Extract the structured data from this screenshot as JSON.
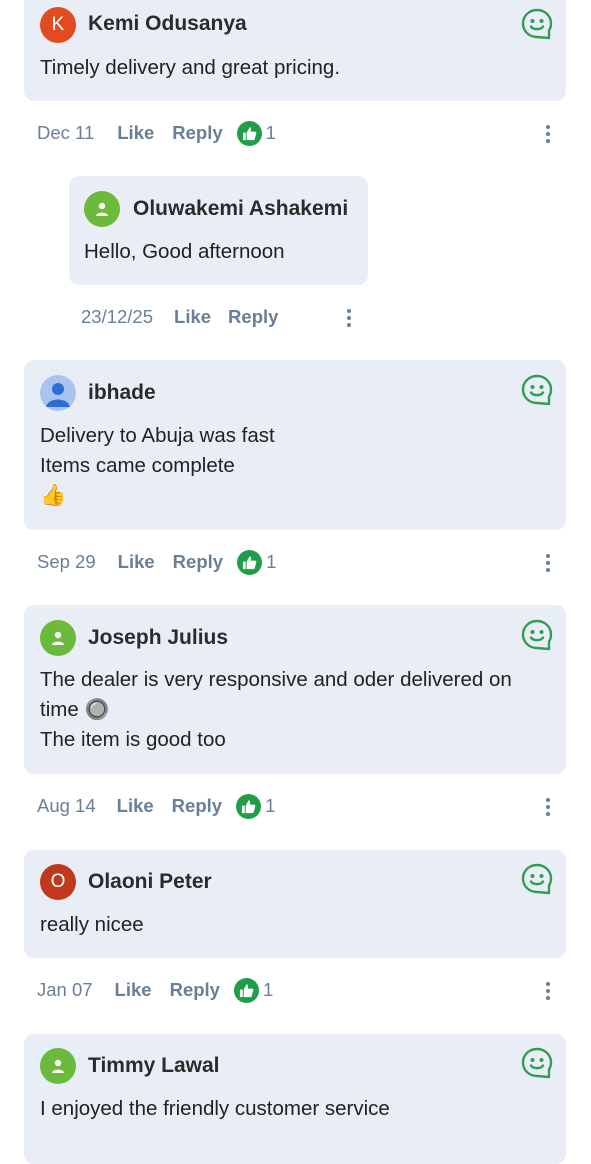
{
  "comments": [
    {
      "author": "Kemi Odusanya",
      "avatar_letter": "K",
      "avatar_color": "#e24a22",
      "lines": [
        "Timely delivery and great pricing."
      ],
      "date": "Dec 11",
      "like_label": "Like",
      "reply_label": "Reply",
      "like_count": "1"
    },
    {
      "author": "Oluwakemi Ashakemi",
      "avatar_icon": "person-icon",
      "avatar_color": "#6cba3c",
      "lines": [
        "Hello, Good afternoon"
      ],
      "date": "23/12/25",
      "like_label": "Like",
      "reply_label": "Reply",
      "is_reply": true
    },
    {
      "author": "ibhade",
      "avatar_icon": "person-icon",
      "avatar_color": "#a9c4ee",
      "lines": [
        "Delivery to Abuja was fast",
        "Items came complete"
      ],
      "emoji": "👍",
      "date": "Sep 29",
      "like_label": "Like",
      "reply_label": "Reply",
      "like_count": "1"
    },
    {
      "author": "Joseph Julius",
      "avatar_icon": "person-icon",
      "avatar_color": "#6cba3c",
      "lines": [
        "The dealer is very responsive and oder delivered on",
        "time",
        "The item is good too"
      ],
      "emoji_after_line_2": "🔘",
      "date": "Aug 14",
      "like_label": "Like",
      "reply_label": "Reply",
      "like_count": "1"
    },
    {
      "author": "Olaoni Peter",
      "avatar_letter": "O",
      "avatar_color": "#c0391b",
      "lines": [
        "really nicee"
      ],
      "date": "Jan 07",
      "like_label": "Like",
      "reply_label": "Reply",
      "like_count": "1"
    },
    {
      "author": "Timmy Lawal",
      "avatar_icon": "person-icon",
      "avatar_color": "#6cba3c",
      "lines": [
        "I enjoyed the friendly customer service"
      ]
    }
  ],
  "icons": {
    "reaction": "smiley-face-icon",
    "like_badge": "thumbs-up-icon",
    "more": "more-vertical-icon"
  },
  "colors": {
    "bubble": "#e9eef6",
    "meta_text": "#6a7f96",
    "like_green": "#1e9e46",
    "smiley_green": "#2f9e52"
  }
}
